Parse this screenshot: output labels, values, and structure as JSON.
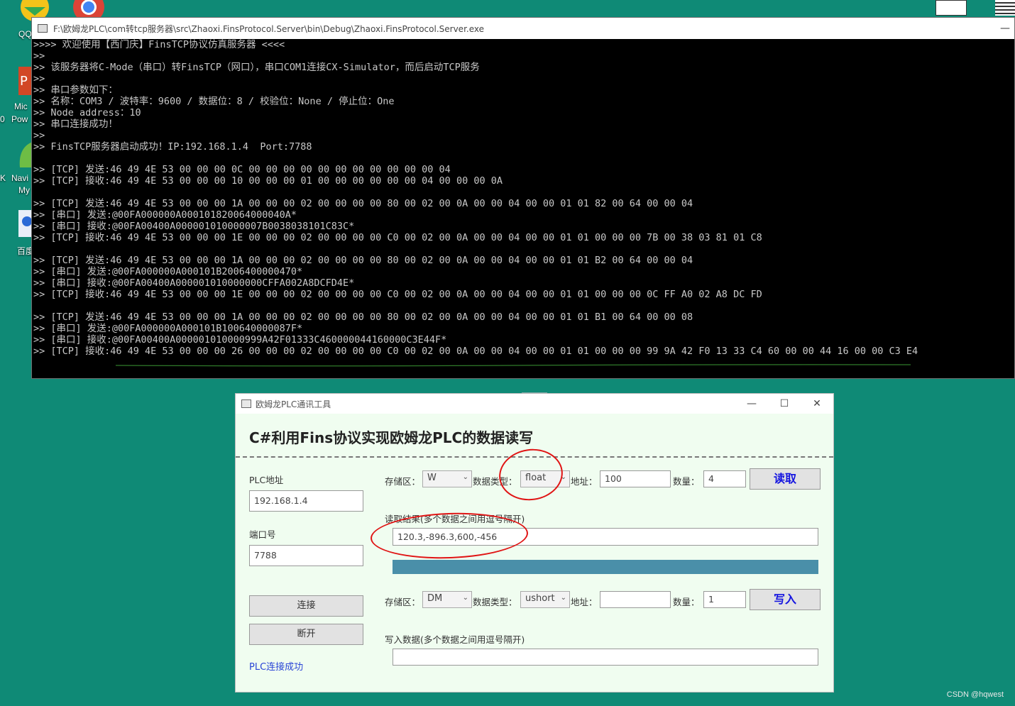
{
  "desktop": {
    "icon_labels": [
      "QQ",
      "Mic",
      "Pow",
      "Navi",
      "My",
      "百度"
    ],
    "left_edge_chars": [
      "0",
      "K"
    ],
    "watermark": "CSDN @hqwest"
  },
  "console": {
    "title": "F:\\欧姆龙PLC\\com转tcp服务器\\src\\Zhaoxi.FinsProtocol.Server\\bin\\Debug\\Zhaoxi.FinsProtocol.Server.exe",
    "minimize": "—",
    "lines": [
      ">>>> 欢迎使用【西门庆】FinsTCP协议仿真服务器 <<<<",
      ">>",
      ">> 该服务器将C-Mode（串口）转FinsTCP（网口），串口COM1连接CX-Simulator，而后启动TCP服务",
      ">>",
      ">> 串口参数如下：",
      ">> 名称：COM3 / 波特率：9600 / 数据位：8 / 校验位：None / 停止位：One",
      ">> Node address：10",
      ">> 串口连接成功！",
      ">>",
      ">> FinsTCP服务器启动成功！IP:192.168.1.4  Port:7788",
      "",
      ">> [TCP] 发送:46 49 4E 53 00 00 00 0C 00 00 00 00 00 00 00 00 00 00 00 04",
      ">> [TCP] 接收:46 49 4E 53 00 00 00 10 00 00 00 01 00 00 00 00 00 00 04 00 00 00 0A",
      "",
      ">> [TCP] 发送:46 49 4E 53 00 00 00 1A 00 00 00 02 00 00 00 00 80 00 02 00 0A 00 00 04 00 00 01 01 82 00 64 00 00 04",
      ">> [串口] 发送:@00FA000000A000101820064000040A*",
      ">> [串口] 接收:@00FA00400A000001010000007B0038038101C83C*",
      ">> [TCP] 接收:46 49 4E 53 00 00 00 1E 00 00 00 02 00 00 00 00 C0 00 02 00 0A 00 00 04 00 00 01 01 00 00 00 7B 00 38 03 81 01 C8",
      "",
      ">> [TCP] 发送:46 49 4E 53 00 00 00 1A 00 00 00 02 00 00 00 00 80 00 02 00 0A 00 00 04 00 00 01 01 B2 00 64 00 00 04",
      ">> [串口] 发送:@00FA000000A000101B2006400000470*",
      ">> [串口] 接收:@00FA00400A000001010000000CFFA002A8DCFD4E*",
      ">> [TCP] 接收:46 49 4E 53 00 00 00 1E 00 00 00 02 00 00 00 00 C0 00 02 00 0A 00 00 04 00 00 01 01 00 00 00 0C FF A0 02 A8 DC FD",
      "",
      ">> [TCP] 发送:46 49 4E 53 00 00 00 1A 00 00 00 02 00 00 00 00 80 00 02 00 0A 00 00 04 00 00 01 01 B1 00 64 00 00 08",
      ">> [串口] 发送:@00FA000000A000101B100640000087F*",
      ">> [串口] 接收:@00FA00400A000001010000999A42F01333C460000044160000C3E44F*",
      ">> [TCP] 接收:46 49 4E 53 00 00 00 26 00 00 00 02 00 00 00 00 C0 00 02 00 0A 00 00 04 00 00 01 01 00 00 00 99 9A 42 F0 13 33 C4 60 00 00 44 16 00 00 C3 E4"
    ]
  },
  "plc": {
    "title": "欧姆龙PLC通讯工具",
    "controls": {
      "minimize": "—",
      "maximize": "☐",
      "close": "✕"
    },
    "heading": "C#利用Fins协议实现欧姆龙PLC的数据读写",
    "left": {
      "ip_label": "PLC地址",
      "ip_value": "192.168.1.4",
      "port_label": "端口号",
      "port_value": "7788",
      "connect": "连接",
      "disconnect": "断开",
      "status": "PLC连接成功"
    },
    "read": {
      "area_label": "存储区：",
      "area_value": "W",
      "type_label": "数据类型：",
      "type_value": "float",
      "addr_label": "地址：",
      "addr_value": "100",
      "count_label": "数量：",
      "count_value": "4",
      "button": "读取",
      "result_label": "读取结果(多个数据之间用逗号隔开)",
      "result_value": "120.3,-896.3,600,-456"
    },
    "write": {
      "area_label": "存储区：",
      "area_value": "DM",
      "type_label": "数据类型：",
      "type_value": "ushort",
      "addr_label": "地址：",
      "addr_value": "",
      "count_label": "数量：",
      "count_value": "1",
      "button": "写入",
      "data_label": "写入数据(多个数据之间用逗号隔开)",
      "data_value": ""
    },
    "colors": {
      "accent_button_text": "#1515e0",
      "progress": "#4a8fa9",
      "annotation": "#e01414",
      "status_text": "#2a45d6"
    }
  }
}
